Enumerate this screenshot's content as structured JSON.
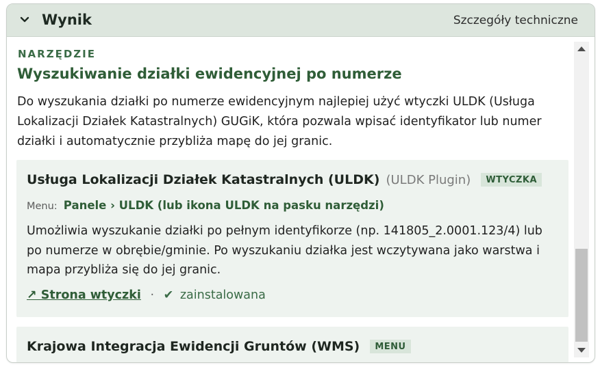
{
  "header": {
    "title": "Wynik",
    "technical_details_link": "Szczegóły techniczne",
    "collapse_icon": "chevron-down-icon"
  },
  "section": {
    "label": "NARZĘDZIE",
    "title": "Wyszukiwanie działki ewidencyjnej po numerze",
    "description": "Do wyszukania działki po numerze ewidencyjnym najlepiej użyć wtyczki ULDK (Usługa Lokalizacji Działek Katastralnych) GUGiK, która pozwala wpisać identyfikator lub numer działki i automatycznie przybliża mapę do jej granic."
  },
  "cards": [
    {
      "title": "Usługa Lokalizacji Działek Katastralnych (ULDK)",
      "subtitle": "(ULDK Plugin)",
      "badge": "WTYCZKA",
      "menu_label": "Menu:",
      "menu_path": "Panele › ULDK (lub ikona ULDK na pasku narzędzi)",
      "description": "Umożliwia wyszukanie działki po pełnym identyfikorze (np. 141805_2.0001.123/4) lub po numerze w obrębie/gminie. Po wyszukaniu działka jest wczytywana jako warstwa i mapa przybliża się do jej granic.",
      "link_label": "↗ Strona wtyczki",
      "separator": "·",
      "status_icon": "✔",
      "status_text": "zainstalowana"
    },
    {
      "title": "Krajowa Integracja Ewidencji Gruntów (WMS)",
      "badge": "MENU"
    }
  ],
  "colors": {
    "accent_green": "#2f5d37",
    "header_bg": "#dde6de",
    "card_bg": "#eef3ef",
    "badge_bg": "#d8e5da"
  }
}
